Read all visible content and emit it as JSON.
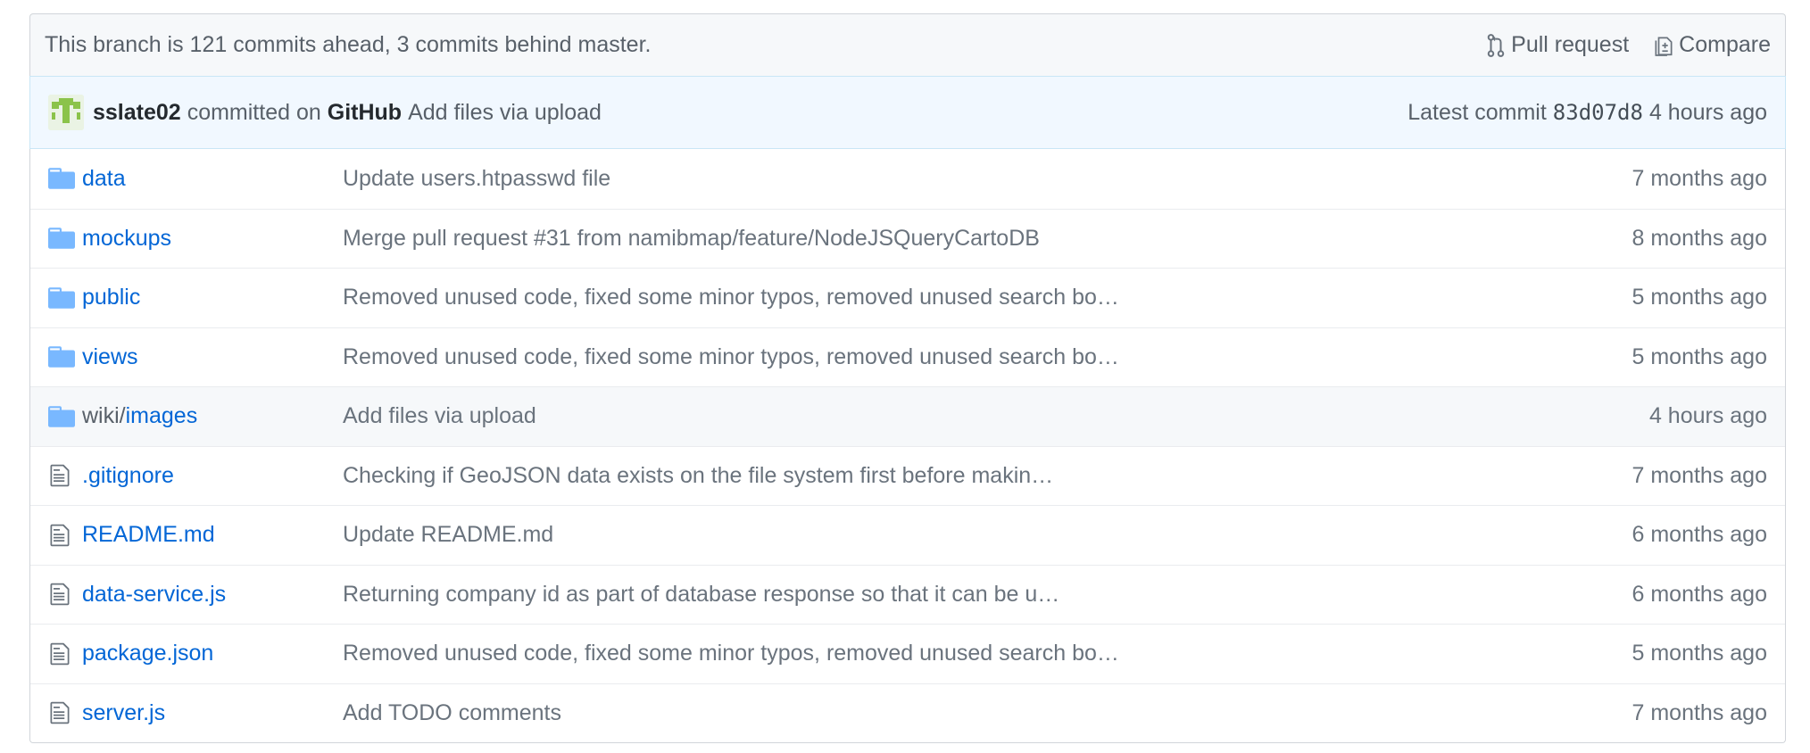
{
  "branch_bar": {
    "status": "This branch is 121 commits ahead, 3 commits behind master.",
    "pull_request_label": "Pull request",
    "compare_label": "Compare"
  },
  "latest_commit": {
    "author": "sslate02",
    "committed_on": "committed on",
    "platform": "GitHub",
    "message": "Add files via upload",
    "latest_label": "Latest commit",
    "sha": "83d07d8",
    "age": "4 hours ago"
  },
  "files": [
    {
      "type": "dir",
      "name": "data",
      "message": "Update users.htpasswd file",
      "age": "7 months ago"
    },
    {
      "type": "dir",
      "name": "mockups",
      "message": "Merge pull request #31 from namibmap/feature/NodeJSQueryCartoDB",
      "age": "8 months ago"
    },
    {
      "type": "dir",
      "name": "public",
      "message": "Removed unused code, fixed some minor typos, removed unused search bo…",
      "age": "5 months ago"
    },
    {
      "type": "dir",
      "name": "views",
      "message": "Removed unused code, fixed some minor typos, removed unused search bo…",
      "age": "5 months ago"
    },
    {
      "type": "dir",
      "prefix": "wiki/",
      "name": "images",
      "message": "Add files via upload",
      "age": "4 hours ago"
    },
    {
      "type": "file",
      "name": ".gitignore",
      "message": "Checking if GeoJSON data exists on the file system first before makin…",
      "age": "7 months ago"
    },
    {
      "type": "file",
      "name": "README.md",
      "message": "Update README.md",
      "age": "6 months ago"
    },
    {
      "type": "file",
      "name": "data-service.js",
      "message": "Returning company id as part of database response so that it can be u…",
      "age": "6 months ago"
    },
    {
      "type": "file",
      "name": "package.json",
      "message": "Removed unused code, fixed some minor typos, removed unused search bo…",
      "age": "5 months ago"
    },
    {
      "type": "file",
      "name": "server.js",
      "message": "Add TODO comments",
      "age": "7 months ago"
    }
  ],
  "icons": {
    "dir": "folder-icon",
    "file": "file-icon",
    "pull_request": "git-pull-request-icon",
    "compare": "diff-icon"
  },
  "colors": {
    "link": "#0366d6",
    "folder": "#79b8ff",
    "commit_bar_bg": "#f1f8ff",
    "avatar_green": "#8bc34a"
  }
}
